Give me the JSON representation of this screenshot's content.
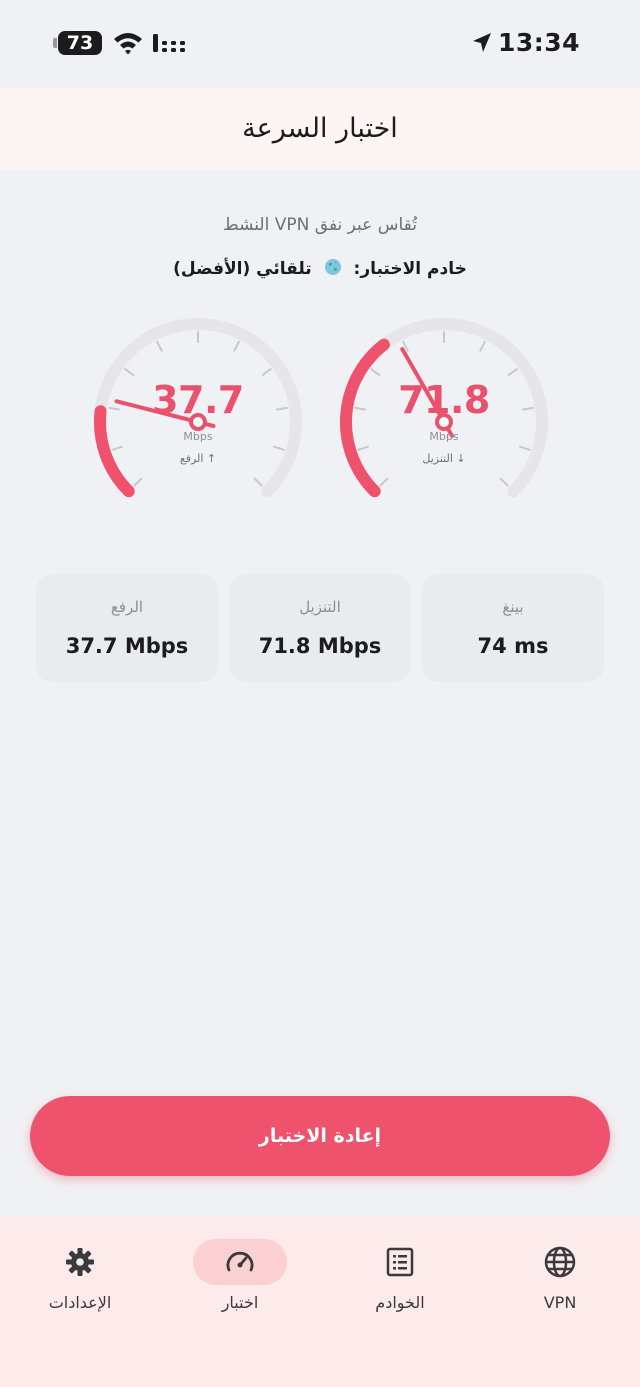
{
  "status_bar": {
    "battery": "73",
    "time": "13:34"
  },
  "header": {
    "title": "اختبار السرعة"
  },
  "info": {
    "subtitle": "تُقاس عبر نفق VPN النشط",
    "server_label": "خادم الاختبار:",
    "server_icon": "globe-icon",
    "server_value": "تلقائي (الأفضل)"
  },
  "gauges": {
    "download": {
      "value": "71.8",
      "unit": "Mbps",
      "label": "↓ التنزيل",
      "fraction": 0.36
    },
    "upload": {
      "value": "37.7",
      "unit": "Mbps",
      "label": "↑ الرفع",
      "fraction": 0.19
    }
  },
  "stats": {
    "ping": {
      "label": "بينغ",
      "value": "74 ms"
    },
    "download": {
      "label": "التنزيل",
      "value": "71.8 Mbps"
    },
    "upload": {
      "label": "الرفع",
      "value": "37.7 Mbps"
    }
  },
  "retest_button": {
    "label": "إعادة الاختبار"
  },
  "nav": {
    "vpn": {
      "label": "VPN",
      "icon": "globe-icon"
    },
    "servers": {
      "label": "الخوادم",
      "icon": "list-icon"
    },
    "test": {
      "label": "اختبار",
      "icon": "speedometer-icon"
    },
    "settings": {
      "label": "الإعدادات",
      "icon": "gear-icon"
    }
  },
  "colors": {
    "accent": "#ef526c",
    "header_bg": "#fdf5f3",
    "nav_bg": "#fdeaea",
    "nav_active_bg": "#fbd0d3"
  }
}
